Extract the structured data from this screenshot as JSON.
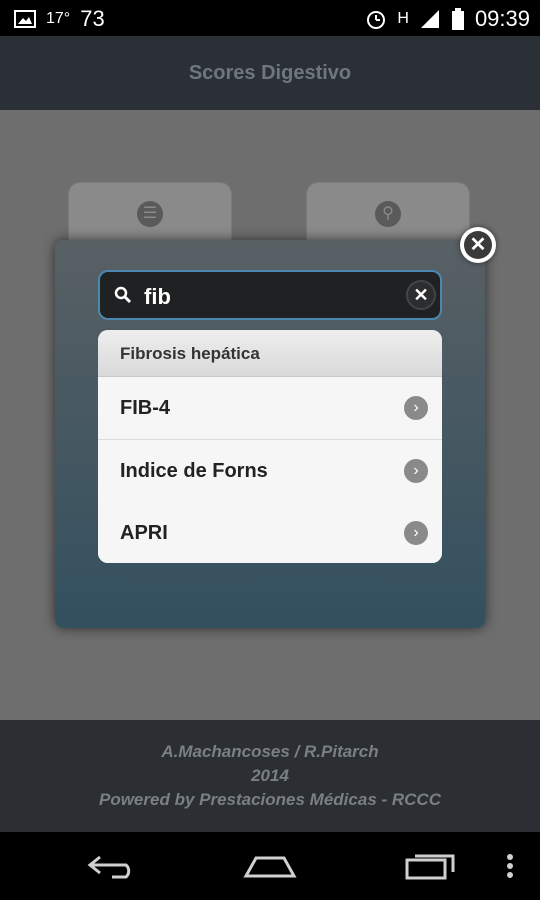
{
  "status_bar": {
    "temperature": "17°",
    "temp_value": "73",
    "network": "H",
    "time": "09:39",
    "icons": [
      "image-icon",
      "alarm-icon",
      "signal-icon",
      "battery-icon"
    ]
  },
  "header": {
    "title": "Scores Digestivo"
  },
  "menu_tiles": [
    {
      "icon": "list-icon"
    },
    {
      "icon": "search-icon"
    }
  ],
  "popup": {
    "search": {
      "value": "fib"
    },
    "group_header": "Fibrosis hepática",
    "items": [
      {
        "label": "FIB-4"
      },
      {
        "label": "Indice de Forns"
      },
      {
        "label": "APRI"
      }
    ]
  },
  "footer": {
    "line1": "A.Machancoses / R.Pitarch",
    "line2": "2014",
    "line3": "Powered by Prestaciones Médicas - RCCC"
  },
  "colors": {
    "accent": "#4d87b0",
    "header_bg": "#2a3036",
    "footer_bg": "#2b2f33"
  }
}
